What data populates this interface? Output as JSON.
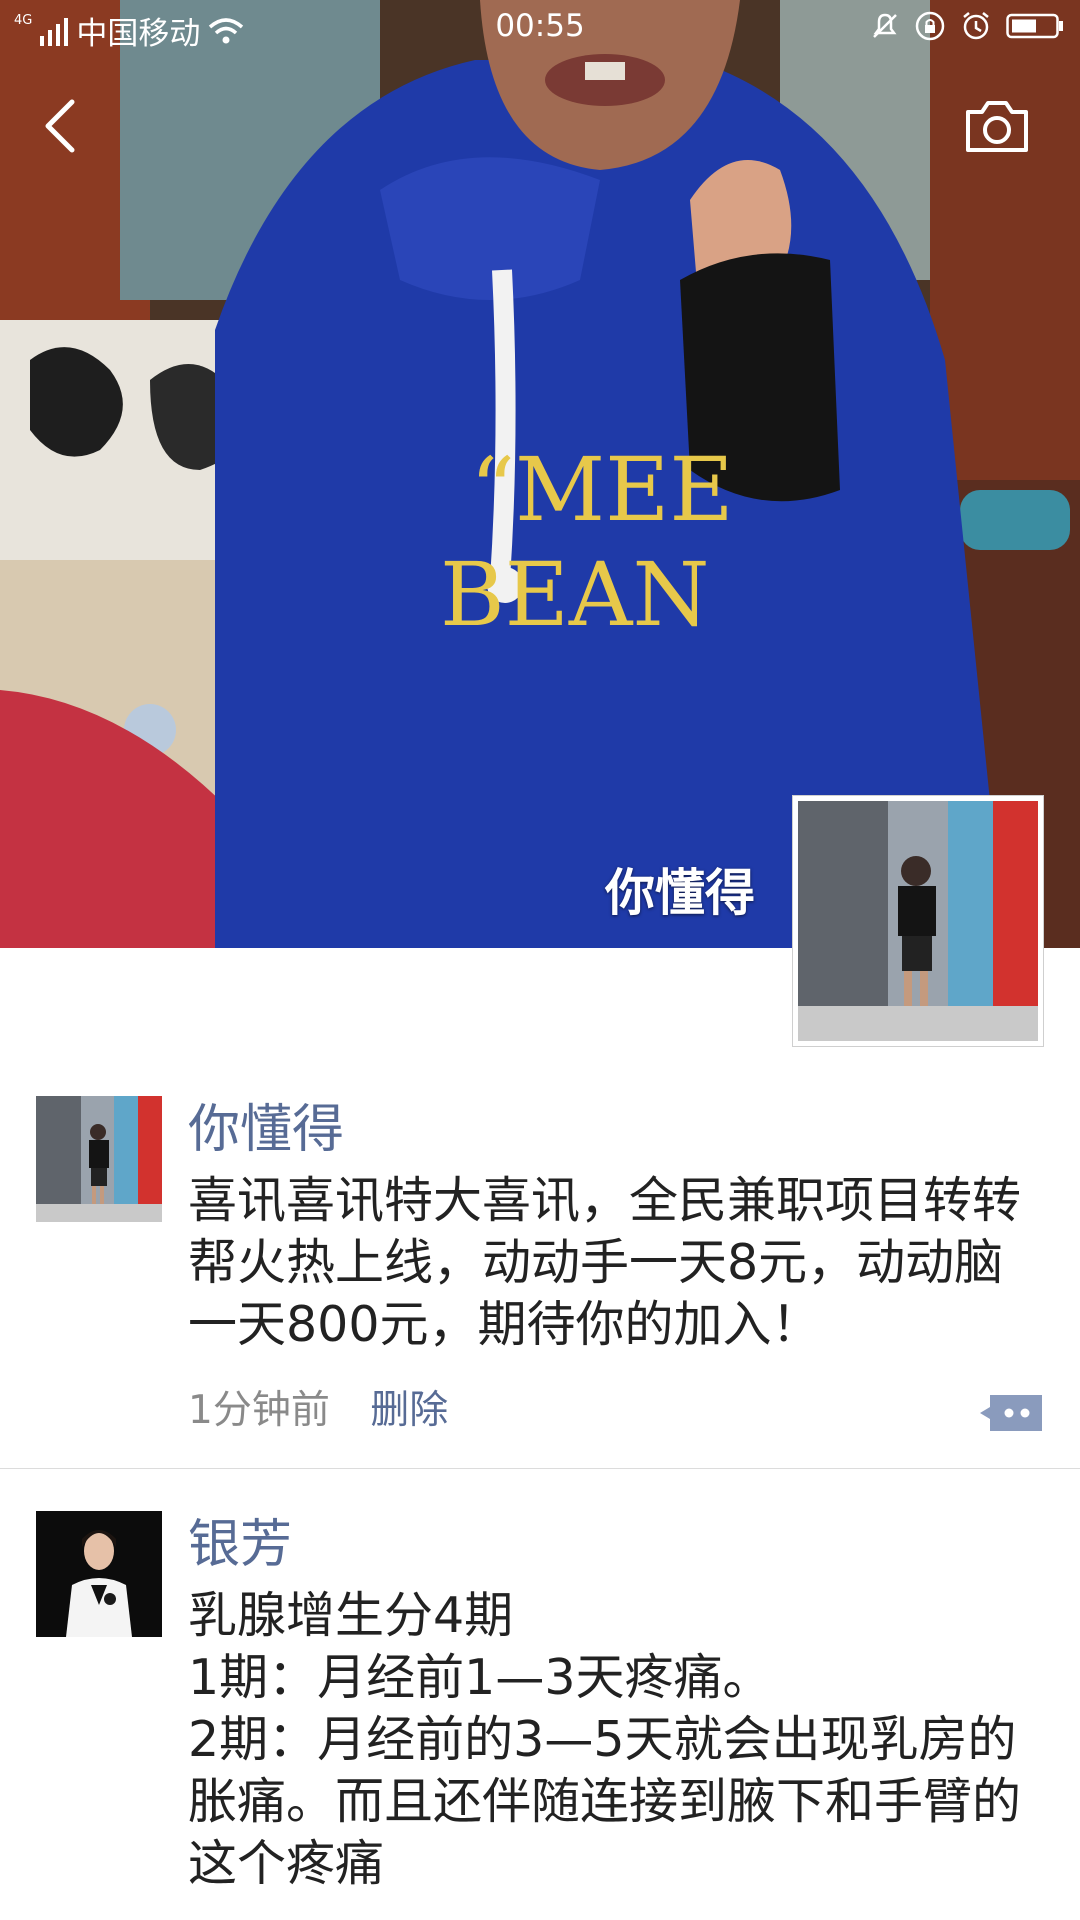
{
  "status_bar": {
    "network": "4G",
    "carrier": "中国移动",
    "time": "00:55"
  },
  "nav": {
    "back_icon": "chevron-left-icon",
    "camera_icon": "camera-icon"
  },
  "profile": {
    "name": "你懂得"
  },
  "posts": [
    {
      "author": "你懂得",
      "text": "喜讯喜讯特大喜讯，全民兼职项目转转帮火热上线，动动手一天8元，动动脑一天800元，期待你的加入！",
      "time": "1分钟前",
      "delete_label": "删除"
    },
    {
      "author": "银芳",
      "text": "乳腺增生分4期\n1期：月经前1—3天疼痛。\n2期：月经前的3—5天就会出现乳房的胀痛。而且还伴随连接到腋下和手臂的这个疼痛"
    }
  ],
  "colors": {
    "link_blue": "#576b95",
    "text_dark": "#222222",
    "meta_gray": "#8a8a8a",
    "divider": "#dcdcdc"
  }
}
